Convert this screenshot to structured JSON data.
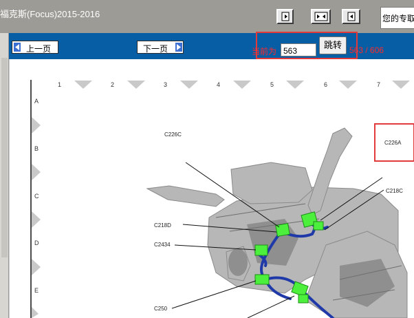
{
  "window": {
    "title": "福克斯(Focus)2015-2016",
    "search_text": "您的专取"
  },
  "toolbar": {
    "buttons": [
      {
        "icon": "single-page-icon"
      },
      {
        "icon": "double-page-icon"
      },
      {
        "icon": "fit-page-icon"
      }
    ]
  },
  "nav": {
    "prev_label": "上一页",
    "next_label": "下一页",
    "current_label": "当前为",
    "current_page": "563",
    "jump_label": "跳转",
    "total_label": "563 / 606"
  },
  "diagram": {
    "columns": [
      "1",
      "2",
      "3",
      "4",
      "5",
      "6",
      "7"
    ],
    "rows": [
      "A",
      "B",
      "C",
      "D",
      "E"
    ],
    "connectors": {
      "c226c": "C226C",
      "c226a": "C226A",
      "c218c": "C218C",
      "c218d": "C218D",
      "c2434": "C2434",
      "c250": "C250"
    }
  },
  "colors": {
    "title_bar": "#9d9b96",
    "nav_bar": "#075ea4",
    "highlight": "#e23a3a",
    "connector_green": "#4cf03c",
    "harness_blue": "#1f3aa8"
  }
}
